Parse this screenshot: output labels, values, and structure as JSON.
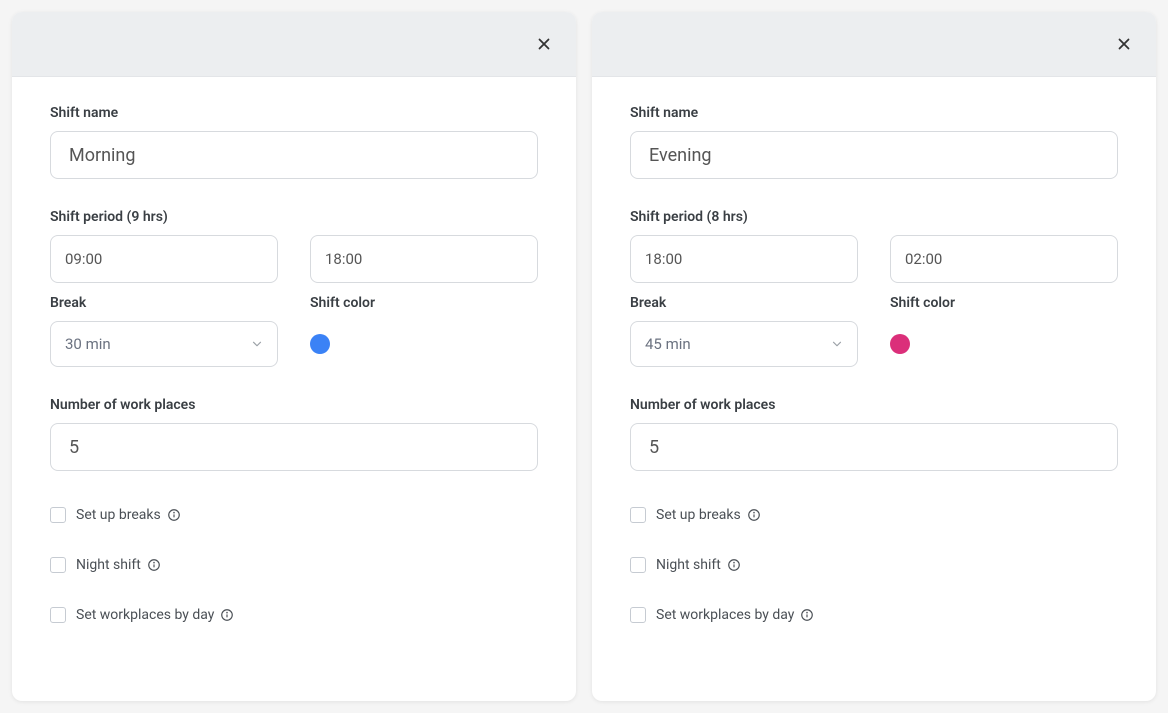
{
  "modals": [
    {
      "labels": {
        "shiftName": "Shift name",
        "shiftPeriod": "Shift period (9 hrs)",
        "break": "Break",
        "shiftColor": "Shift color",
        "numWorkplaces": "Number of work places",
        "setUpBreaks": "Set up breaks",
        "nightShift": "Night shift",
        "setWorkplacesByDay": "Set workplaces by day"
      },
      "values": {
        "shiftName": "Morning",
        "startTime": "09:00",
        "endTime": "18:00",
        "breakSelected": "30 min",
        "shiftColorHex": "#3b82f6",
        "numWorkplaces": "5"
      }
    },
    {
      "labels": {
        "shiftName": "Shift name",
        "shiftPeriod": "Shift period (8 hrs)",
        "break": "Break",
        "shiftColor": "Shift color",
        "numWorkplaces": "Number of work places",
        "setUpBreaks": "Set up breaks",
        "nightShift": "Night shift",
        "setWorkplacesByDay": "Set workplaces by day"
      },
      "values": {
        "shiftName": "Evening",
        "startTime": "18:00",
        "endTime": "02:00",
        "breakSelected": "45 min",
        "shiftColorHex": "#db2f7a",
        "numWorkplaces": "5"
      }
    }
  ]
}
